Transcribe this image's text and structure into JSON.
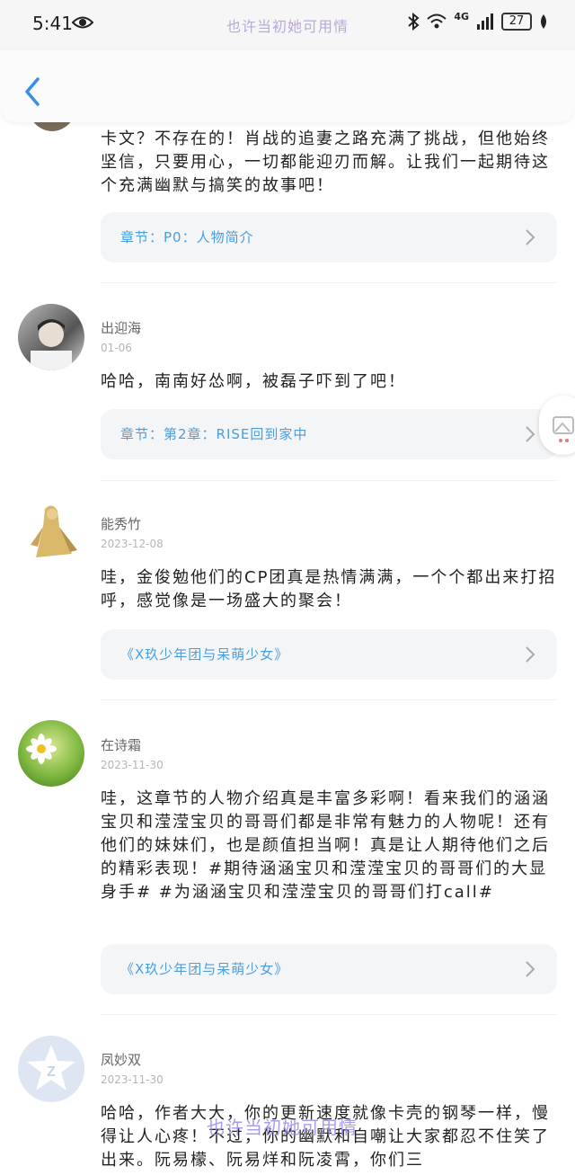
{
  "status_bar": {
    "time": "5:41",
    "watermark": "也许当初她可用情",
    "network": "4G",
    "battery": "27"
  },
  "comments": [
    {
      "text": "卡文？不存在的！肖战的追妻之路充满了挑战，但他始终坚信，只要用心，一切都能迎刃而解。让我们一起期待这个充满幽默与搞笑的故事吧！",
      "chapter": "章节：P0：人物简介"
    },
    {
      "user": "出迎海",
      "date": "01-06",
      "text": "哈哈，南南好怂啊，被磊子吓到了吧！",
      "chapter": "章节：第2章：RISE回到家中"
    },
    {
      "user": "能秀竹",
      "date": "2023-12-08",
      "text": "哇，金俊勉他们的CP团真是热情满满，一个个都出来打招呼，感觉像是一场盛大的聚会！",
      "chapter": "《X玖少年团与呆萌少女》"
    },
    {
      "user": "在诗霜",
      "date": "2023-11-30",
      "text": "哇，这章节的人物介绍真是丰富多彩啊！看来我们的涵涵宝贝和滢滢宝贝的哥哥们都是非常有魅力的人物呢！还有他们的妹妹们，也是颜值担当啊！真是让人期待他们之后的精彩表现！#期待涵涵宝贝和滢滢宝贝的哥哥们的大显身手# #为涵涵宝贝和滢滢宝贝的哥哥们打call#",
      "chapter": "《X玖少年团与呆萌少女》"
    },
    {
      "user": "凤妙双",
      "date": "2023-11-30",
      "text": "哈哈，作者大大，你的更新速度就像卡壳的钢琴一样，慢得让人心疼！不过，你的幽默和自嘲让大家都忍不住笑了出来。阮易檬、阮易烊和阮凌霄，你们三"
    }
  ],
  "bottom_watermark": "也许当初她可用情",
  "colors": {
    "accent": "#4a9de0",
    "card_bg": "#f4f5f7"
  }
}
